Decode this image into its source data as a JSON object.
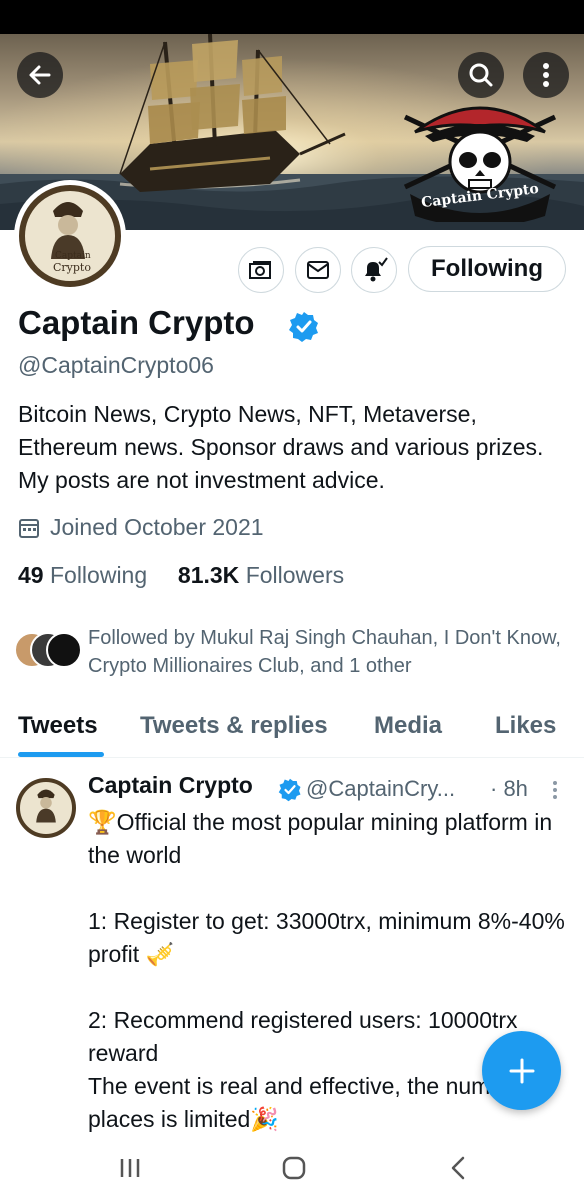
{
  "header": {
    "back_icon": "arrow-left-icon",
    "search_icon": "search-icon",
    "more_icon": "more-vertical-icon",
    "banner_logo_text": "Captain Crypto"
  },
  "profile": {
    "avatar_text_line1": "Captain",
    "avatar_text_line2": "Crypto",
    "display_name": "Captain Crypto",
    "handle": "@CaptainCrypto06",
    "bio": "Bitcoin News, Crypto News, NFT, Metaverse, Ethereum news. Sponsor draws and various prizes. My posts are not investment advice.",
    "joined": "Joined October 2021",
    "following_count": "49",
    "following_label": "Following",
    "followers_count": "81.3K",
    "followers_label": "Followers",
    "followed_by": "Followed by Mukul Raj Singh Chauhan, I Don't Know, Crypto Millionaires Club, and 1 other",
    "follow_button_label": "Following",
    "accent_color": "#1d9bf0"
  },
  "tabs": [
    {
      "label": "Tweets",
      "active": true
    },
    {
      "label": "Tweets & replies",
      "active": false
    },
    {
      "label": "Media",
      "active": false
    },
    {
      "label": "Likes",
      "active": false
    }
  ],
  "tweet": {
    "name": "Captain Crypto",
    "handle": "@CaptainCry...",
    "time": "· 8h",
    "lines": [
      "🏆Official the most popular mining platform in the world",
      "",
      "1: Register to get: 33000trx, minimum 8%-40% profit 🎺",
      "",
      "2: Recommend registered users: 10000trx reward",
      "The event is real and effective, the number of places is limited🎉"
    ]
  }
}
